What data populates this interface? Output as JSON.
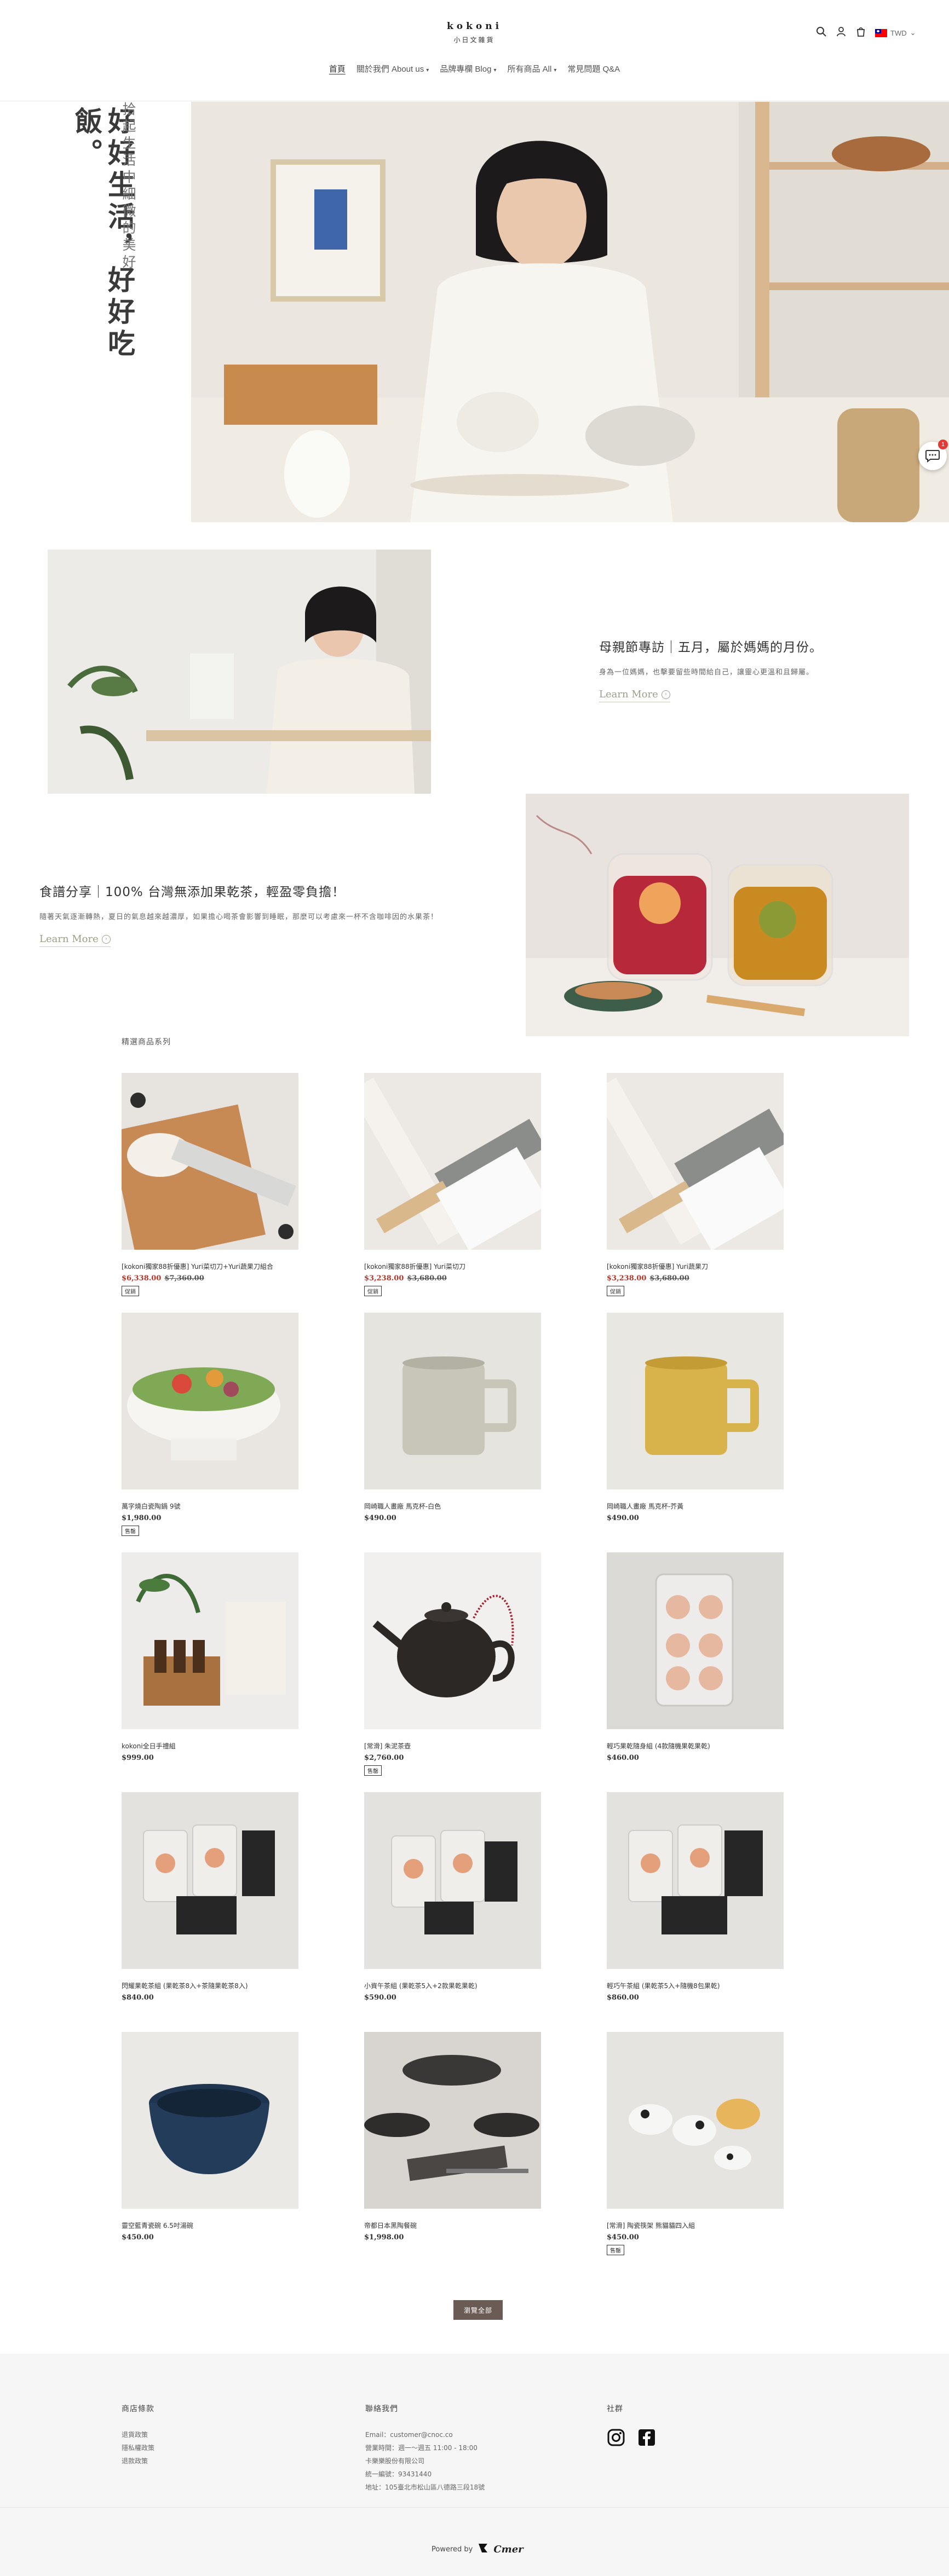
{
  "header": {
    "logo_line1": "kokoni",
    "logo_line2": "小日文雜貨",
    "currency": "TWD"
  },
  "nav": [
    {
      "label": "首頁",
      "has_dropdown": false,
      "active": true
    },
    {
      "label": "關於我們 About us",
      "has_dropdown": true,
      "active": false
    },
    {
      "label": "品牌專欄 Blog",
      "has_dropdown": true,
      "active": false
    },
    {
      "label": "所有商品 All",
      "has_dropdown": true,
      "active": false
    },
    {
      "label": "常見問題 Q&A",
      "has_dropdown": false,
      "active": false
    }
  ],
  "hero": {
    "vertical_main": "好好生活，好好吃飯。",
    "vertical_sub": "拾起生活中細微的美好"
  },
  "features": [
    {
      "title": "母親節專訪｜五月，屬於媽媽的月份。",
      "desc": "身為一位媽媽，也擊要留些時間給自己，讓靈心更溫和且歸屬。",
      "learn_more": "Learn More"
    },
    {
      "title": "食譜分享｜100% 台灣無添加果乾茶，輕盈零負擔！",
      "desc": "隨著天氣逐漸轉熱，夏日的氣息越來越濃厚，如果擔心喝茶會影響到睡眠，那麼可以考慮來一杯不含咖啡因的水果茶！",
      "learn_more": "Learn More"
    }
  ],
  "products_section": {
    "title": "精選商品系列",
    "more_button": "瀏覽全部",
    "items": [
      {
        "name": "[kokoni獨家88折優惠] Yuri菜切刀+Yuri蔬果刀組合",
        "sale_price": "$6,338.00",
        "orig_price": "$7,360.00",
        "badge": "促銷"
      },
      {
        "name": "[kokoni獨家88折優惠] Yuri菜切刀",
        "sale_price": "$3,238.00",
        "orig_price": "$3,680.00",
        "badge": "促銷"
      },
      {
        "name": "[kokoni獨家88折優惠] Yuri蔬果刀",
        "sale_price": "$3,238.00",
        "orig_price": "$3,680.00",
        "badge": "促銷"
      },
      {
        "name": "萬字燒白瓷陶鍋 9號",
        "price": "$1,980.00",
        "badge": "售罄"
      },
      {
        "name": "岡崎職人畫廠 馬克杯-白色",
        "price": "$490.00"
      },
      {
        "name": "岡崎職人畫廠 馬克杯-芥黃",
        "price": "$490.00"
      },
      {
        "name": "kokoni全日手禮組",
        "price": "$999.00"
      },
      {
        "name": "[常滑] 朱泥茶壺",
        "price": "$2,760.00",
        "badge": "售罄"
      },
      {
        "name": "輕巧果乾隨身組 (4款隨機果乾果乾)",
        "price": "$460.00"
      },
      {
        "name": "閃耀果乾茶組 (果乾茶8入+茶隨果乾茶8入)",
        "price": "$840.00"
      },
      {
        "name": "小資午茶組 (果乾茶5入+2款果乾果乾)",
        "price": "$590.00"
      },
      {
        "name": "輕巧午茶組 (果乾茶5入+隨機8包果乾)",
        "price": "$860.00"
      },
      {
        "name": "靈空藍青瓷碗 6.5吋湯碗",
        "price": "$450.00"
      },
      {
        "name": "帝都日本黑陶餐碗",
        "price": "$1,998.00"
      },
      {
        "name": "[常滑] 陶瓷筷架 熊貓貓四入組",
        "price": "$450.00",
        "badge": "售罄"
      }
    ]
  },
  "footer": {
    "col1": {
      "title": "商店條款",
      "links": [
        "退貨政策",
        "隱私權政策",
        "退款政策"
      ]
    },
    "col2": {
      "title": "聯絡我們",
      "lines": [
        "Email：customer@cnoc.co",
        "營業時間：週一～週五 11:00 - 18:00",
        "卡樂樂股份有限公司",
        "統一編號：93431440",
        "地址：105臺北市松山區八德路三段18號"
      ]
    },
    "col3": {
      "title": "社群"
    },
    "powered_by": "Powered by",
    "platform": "Cmer"
  }
}
